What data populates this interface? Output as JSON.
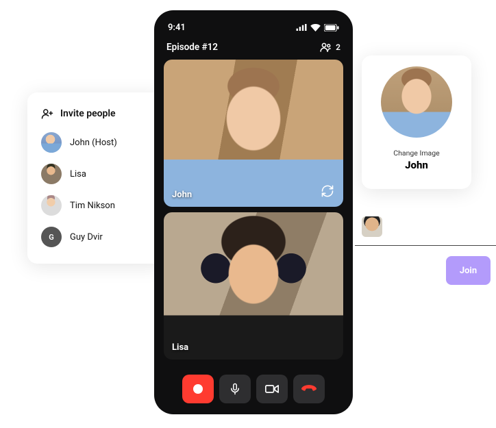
{
  "invite": {
    "header": "Invite people",
    "people": [
      {
        "name": "John (Host)"
      },
      {
        "name": "Lisa"
      },
      {
        "name": "Tim Nikson"
      },
      {
        "name": "Guy Dvir",
        "initial": "G"
      }
    ]
  },
  "phone": {
    "time": "9:41",
    "title": "Episode #12",
    "participant_count": "2",
    "tiles": [
      {
        "label": "John"
      },
      {
        "label": "Lisa"
      }
    ]
  },
  "profile": {
    "change_label": "Change Image",
    "name": "John"
  },
  "join": {
    "label": "Join"
  }
}
